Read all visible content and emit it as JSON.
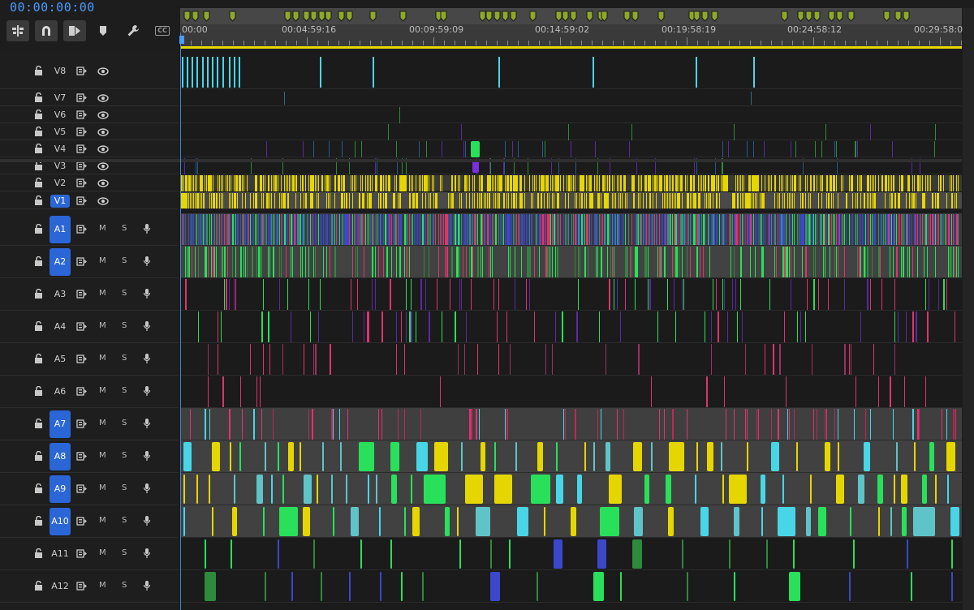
{
  "timecode": "00:00:00:00",
  "toolbar": {
    "nest_icon": "nest-sequence-icon",
    "snap_icon": "snap-magnet-icon",
    "linked_icon": "linked-selection-icon",
    "marker_icon": "add-marker-icon",
    "settings_icon": "wrench-icon",
    "captions_label": "CC"
  },
  "ruler": {
    "labels": [
      "00:00",
      "00:04:59:16",
      "00:09:59:09",
      "00:14:59:02",
      "00:19:58:19",
      "00:24:58:12",
      "00:29:58:04"
    ]
  },
  "colors": {
    "accent": "#2b66d6",
    "timecode": "#4b9cff",
    "playhead": "#3d83e0",
    "marker": "#8fa82a",
    "ruler_range": "#e8d800",
    "video_clip": "#e6d600",
    "audio_blue": "#3a48c9",
    "audio_green": "#29e05a",
    "audio_magenta": "#e0336e",
    "audio_teal": "#5fc4c8",
    "audio_cyan": "#48d6e6",
    "clip_bg": "#464646"
  },
  "video_tracks": [
    {
      "name": "V8",
      "targeted": false
    },
    {
      "name": "V7",
      "targeted": false
    },
    {
      "name": "V6",
      "targeted": false
    },
    {
      "name": "V5",
      "targeted": false
    },
    {
      "name": "V4",
      "targeted": false
    },
    {
      "name": "V3",
      "targeted": false
    },
    {
      "name": "V2",
      "targeted": false
    },
    {
      "name": "V1",
      "targeted": true
    }
  ],
  "audio_tracks": [
    {
      "name": "A1",
      "targeted": true
    },
    {
      "name": "A2",
      "targeted": true
    },
    {
      "name": "A3",
      "targeted": false
    },
    {
      "name": "A4",
      "targeted": false
    },
    {
      "name": "A5",
      "targeted": false
    },
    {
      "name": "A6",
      "targeted": false
    },
    {
      "name": "A7",
      "targeted": true
    },
    {
      "name": "A8",
      "targeted": true
    },
    {
      "name": "A9",
      "targeted": true
    },
    {
      "name": "A10",
      "targeted": true
    },
    {
      "name": "A11",
      "targeted": false
    },
    {
      "name": "A12",
      "targeted": false
    }
  ],
  "track_controls": {
    "lock_icon": "lock-icon",
    "sync_icon": "sync-lock-icon",
    "eye_icon": "eye-icon",
    "mic_icon": "microphone-icon",
    "mute_label": "M",
    "solo_label": "S"
  }
}
